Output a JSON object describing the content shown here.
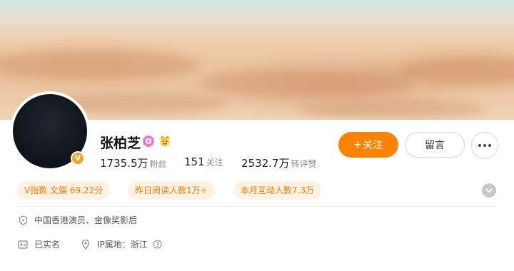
{
  "profile": {
    "name": "张柏芝",
    "avatar_badge": "V",
    "stats": [
      {
        "value": "1735.5万",
        "label": "粉丝"
      },
      {
        "value": "151",
        "label": "关注"
      },
      {
        "value": "2532.7万",
        "label": "转评赞"
      }
    ]
  },
  "actions": {
    "follow_plus": "+",
    "follow_label": "关注",
    "message_label": "留言"
  },
  "tags": [
    "V指数 文娱 69.22分",
    "昨日阅读人数1万+",
    "本月互动人数7.3万"
  ],
  "info": {
    "bio": "中国香港演员、金像奖影后",
    "verified": "已实名",
    "ip_label": "IP属地：浙江"
  },
  "icons": {
    "name_badge_1": "pink-circle-badge-icon",
    "name_badge_2": "crown-face-icon",
    "more": "more-dots-icon",
    "expand": "chevron-down-icon",
    "bio": "shield-icon",
    "verified": "id-card-icon",
    "ip": "location-pin-icon",
    "help": "question-circle-icon"
  },
  "colors": {
    "accent": "#ff8200",
    "tag_bg": "#fff1e4",
    "tag_text": "#ff7a00"
  }
}
